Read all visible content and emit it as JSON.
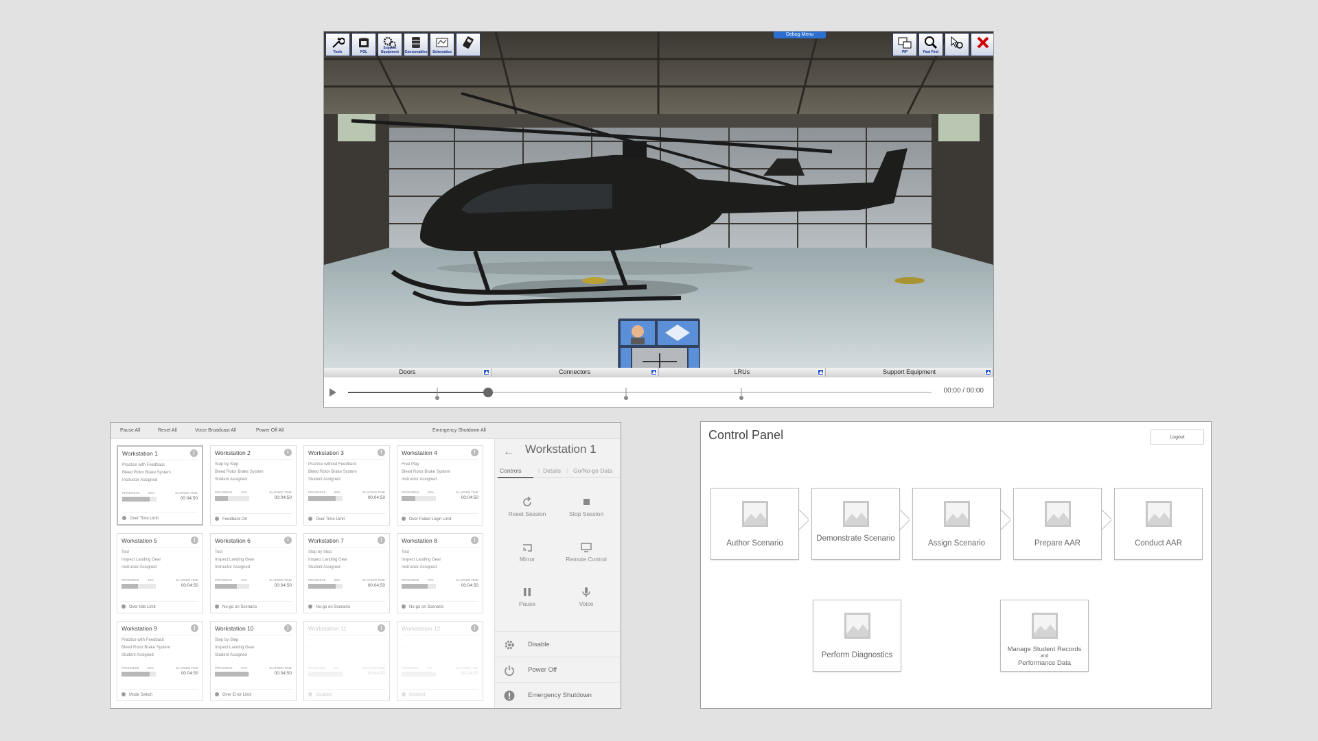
{
  "simulator": {
    "toolbar_left": [
      {
        "label": "Tools",
        "icon": "wrench-icon"
      },
      {
        "label": "POL",
        "icon": "oil-can-icon"
      },
      {
        "label": "Support Equipment",
        "icon": "gears-icon"
      },
      {
        "label": "Consumables",
        "icon": "barrel-icon"
      },
      {
        "label": "Schematics",
        "icon": "schematic-icon"
      },
      {
        "label": "",
        "icon": "multimeter-icon"
      }
    ],
    "toolbar_right": [
      {
        "label": "PIP",
        "icon": "pip-icon"
      },
      {
        "label": "Fast Find",
        "icon": "fast-find-icon"
      },
      {
        "label": "",
        "icon": "cursor-zoom-icon"
      },
      {
        "label": "",
        "icon": "close-x-icon"
      }
    ],
    "debug_menu": "Debug Menu",
    "bottom_tabs": [
      "Doors",
      "Connectors",
      "LRUs",
      "Support Equipment"
    ],
    "player": {
      "time": "00:00 / 00:00",
      "progress": 0.24
    }
  },
  "workstations": {
    "topbar": {
      "pause_all": "Pause All",
      "reset_all": "Reset All",
      "voice_broadcast_all": "Voice Broadcast All",
      "power_off_all": "Power Off All",
      "emergency_shutdown_all": "Emergency Shutdown All"
    },
    "progress_label": "PROGRESS",
    "elapsed_label": "ELAPSED TIME",
    "cards": [
      {
        "title": "Workstation 1",
        "mode": "Practice with Feedback",
        "task": "Bleed Rotor Brake System",
        "assign": "Instructor Assigned",
        "progress": "80%",
        "progress_frac": 0.8,
        "time": "00:04:50",
        "status": "Over Time Limit",
        "selected": true
      },
      {
        "title": "Workstation 2",
        "mode": "Step by Step",
        "task": "Bleed Rotor Brake System",
        "assign": "Student Assigned",
        "progress": "37%",
        "progress_frac": 0.37,
        "time": "00:04:50",
        "status": "Feedback On"
      },
      {
        "title": "Workstation 3",
        "mode": "Practice without Feedback",
        "task": "Bleed Rotor Brake System",
        "assign": "Student Assigned",
        "progress": "80%",
        "progress_frac": 0.8,
        "time": "00:04:50",
        "status": "Over Time Limit"
      },
      {
        "title": "Workstation 4",
        "mode": "Free Play",
        "task": "Bleed Rotor Brake System",
        "assign": "Instructor Assigned",
        "progress": "39%",
        "progress_frac": 0.39,
        "time": "00:04:50",
        "status": "Over Failed Login Limit"
      },
      {
        "title": "Workstation 5",
        "mode": "Test",
        "task": "Inspect Landing Gear",
        "assign": "Instructor Assigned",
        "progress": "48%",
        "progress_frac": 0.48,
        "time": "00:04:50",
        "status": "Over Idle Limit"
      },
      {
        "title": "Workstation 6",
        "mode": "Test",
        "task": "Inspect Landing Gear",
        "assign": "Instructor Assigned",
        "progress": "64%",
        "progress_frac": 0.64,
        "time": "00:04:50",
        "status": "No-go on Scenario"
      },
      {
        "title": "Workstation 7",
        "mode": "Step by Step",
        "task": "Inspect Landing Gear",
        "assign": "Student Assigned",
        "progress": "80%",
        "progress_frac": 0.8,
        "time": "00:04:50",
        "status": "No-go on Scenario"
      },
      {
        "title": "Workstation 8",
        "mode": "Test",
        "task": "Inspect Landing Gear",
        "assign": "Instructor Assigned",
        "progress": "75%",
        "progress_frac": 0.75,
        "time": "00:04:50",
        "status": "No-go on Scenario"
      },
      {
        "title": "Workstation 9",
        "mode": "Practice with Feedback",
        "task": "Bleed Rotor Brake System",
        "assign": "Student Assigned",
        "progress": "82%",
        "progress_frac": 0.82,
        "time": "00:04:50",
        "status": "Mode Switch"
      },
      {
        "title": "Workstation 10",
        "mode": "Step by Step",
        "task": "Inspect Landing Gear",
        "assign": "Student Assigned",
        "progress": "97%",
        "progress_frac": 0.97,
        "time": "00:04:50",
        "status": "Over Error Limit"
      },
      {
        "title": "Workstation 11",
        "mode": "-",
        "task": "-",
        "assign": "",
        "progress": "0%",
        "progress_frac": 0,
        "time": "00:04:50",
        "status": "Disabled",
        "disabled": true
      },
      {
        "title": "Workstation 12",
        "mode": "-",
        "task": "-",
        "assign": "",
        "progress": "0%",
        "progress_frac": 0,
        "time": "00:04:50",
        "status": "Disabled",
        "disabled": true
      }
    ],
    "side": {
      "title": "Workstation 1",
      "tabs": [
        "Controls",
        "Details",
        "Go/No-go Data"
      ],
      "controls": [
        "Reset Session",
        "Stop Session",
        "Mirror",
        "Remote Control",
        "Pause",
        "Voice"
      ],
      "list": [
        "Disable",
        "Power Off",
        "Emergency Shutdown"
      ]
    }
  },
  "control_panel": {
    "title": "Control Panel",
    "logout": "Logout",
    "workflow": [
      "Author Scenario",
      "Demonstrate Scenario",
      "Assign Scenario",
      "Prepare AAR",
      "Conduct AAR"
    ],
    "extra": [
      "Perform Diagnostics"
    ],
    "manage": {
      "line1": "Manage Student Records",
      "line2": "and",
      "line3": "Performance Data"
    }
  }
}
